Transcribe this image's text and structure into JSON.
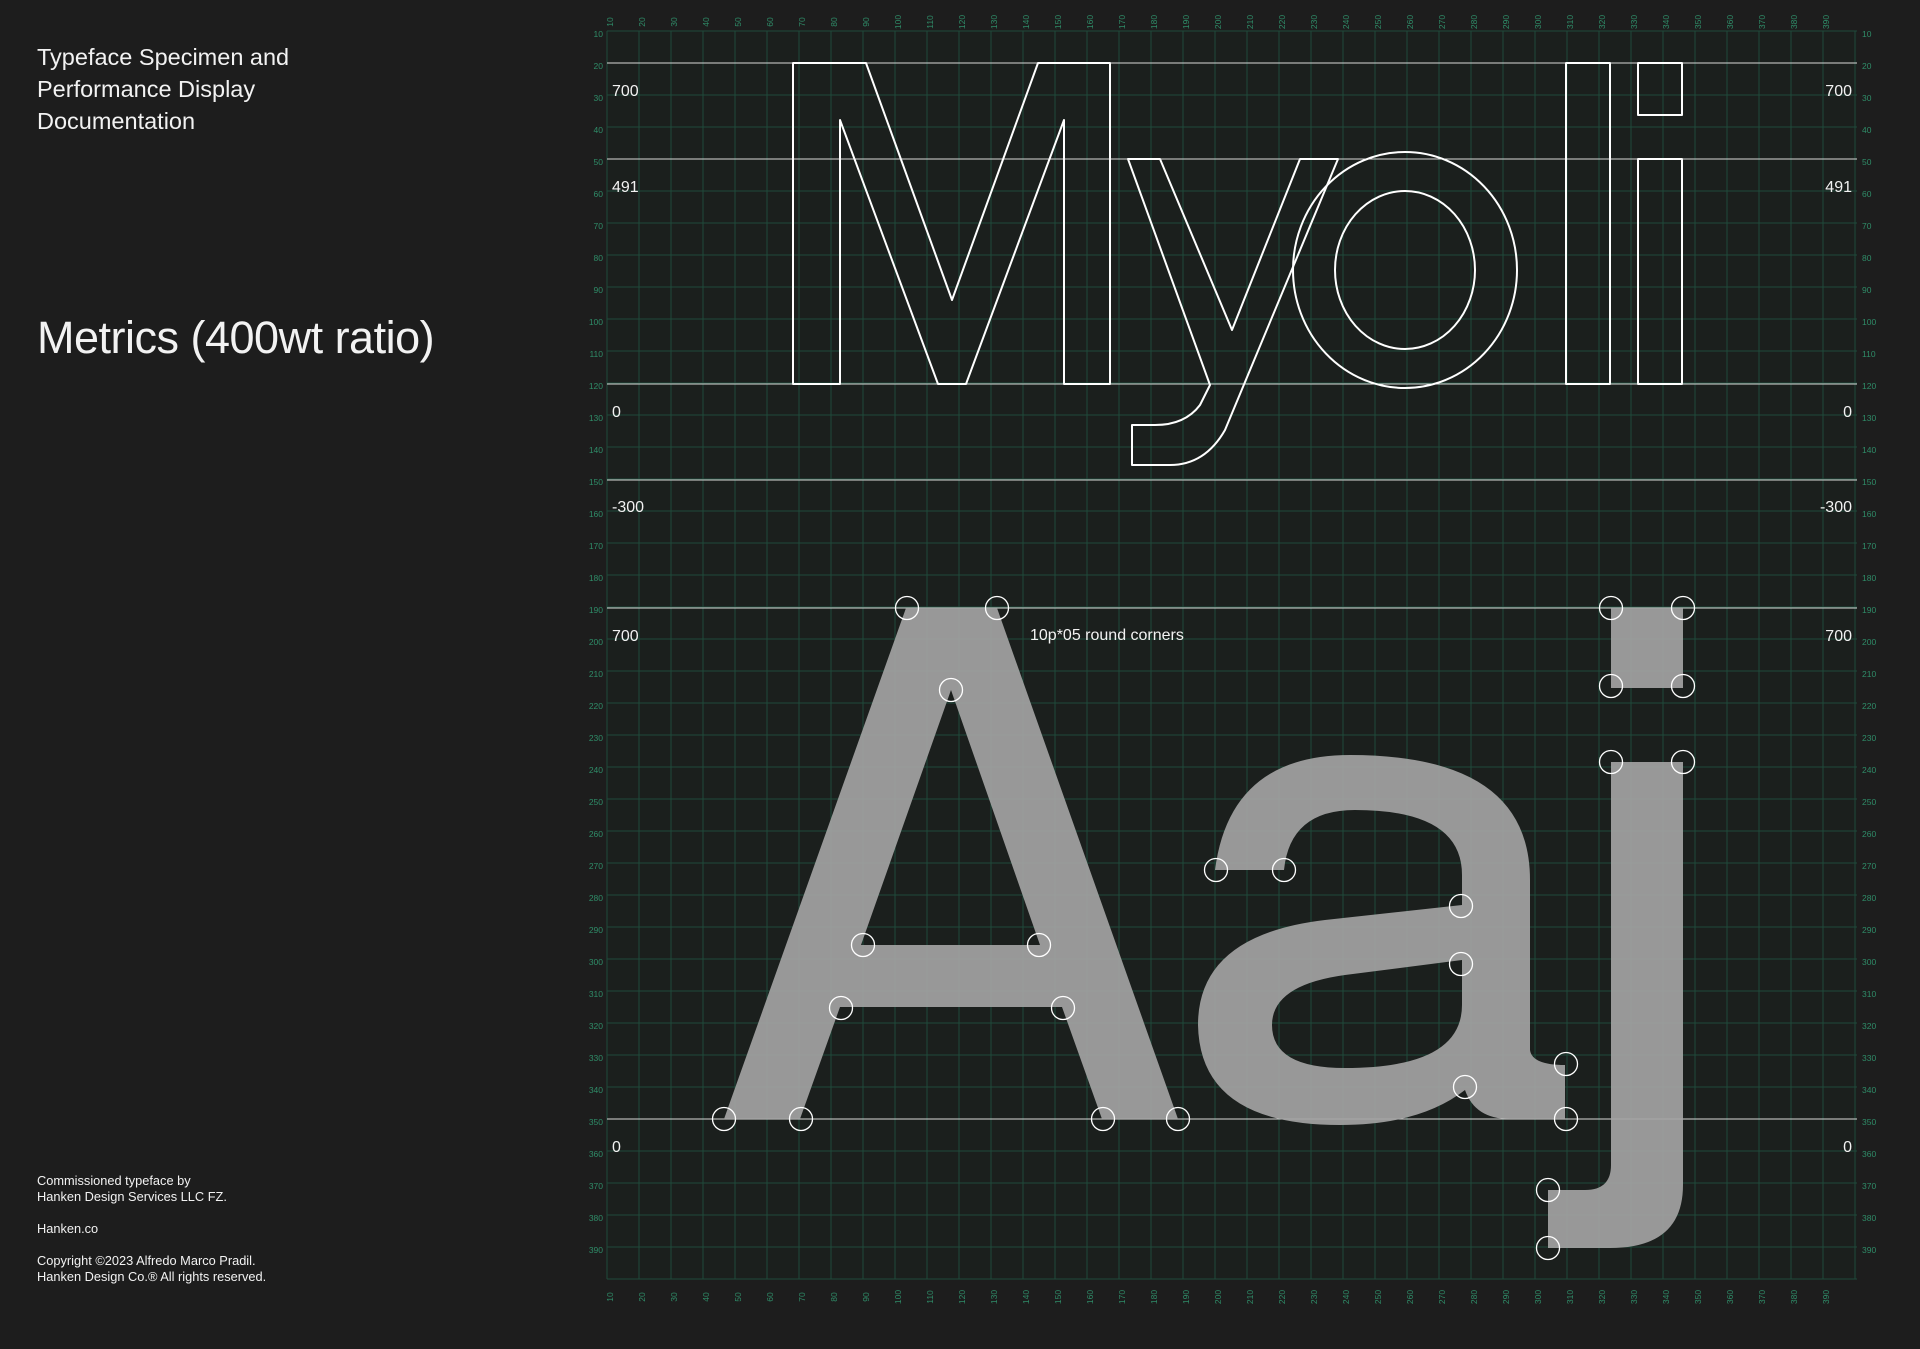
{
  "header": {
    "doc_title": "Typeface Specimen and\nPerformance Display\nDocumentation",
    "section_title": "Metrics (400wt ratio)"
  },
  "specimen_outline": {
    "glyphs": "Myoli",
    "metric_labels": [
      "700",
      "491",
      "0",
      "-300"
    ]
  },
  "specimen_filled": {
    "glyphs": "Aaj",
    "metric_labels": [
      "700",
      "0"
    ],
    "annotation": "10p*05 round corners"
  },
  "grid": {
    "x_ticks": [
      10,
      20,
      30,
      40,
      50,
      60,
      70,
      80,
      90,
      100,
      110,
      120,
      130,
      140,
      150,
      160,
      170,
      180,
      190,
      200,
      210,
      220,
      230,
      240,
      250,
      260,
      270,
      280,
      290,
      300,
      310,
      320,
      330,
      340,
      350,
      360,
      370,
      380,
      390
    ],
    "y_ticks": [
      10,
      20,
      30,
      40,
      50,
      60,
      70,
      80,
      90,
      100,
      110,
      120,
      130,
      140,
      150,
      160,
      170,
      180,
      190,
      200,
      210,
      220,
      230,
      240,
      250,
      260,
      270,
      280,
      290,
      300,
      310,
      320,
      330,
      340,
      350,
      360,
      370,
      380,
      390
    ]
  },
  "footer": {
    "commission": "Commissioned typeface by\nHanken Design Services LLC FZ.",
    "website": "Hanken.co",
    "copyright": "Copyright ©2023 Alfredo Marco Pradil.\nHanken Design Co.® All rights reserved."
  },
  "colors": {
    "background": "#1d1d1d",
    "grid": "#1f4a3a",
    "axis_text": "#2f8c68",
    "outline": "#ffffff",
    "fill_glyph": "#a3a3a3"
  }
}
